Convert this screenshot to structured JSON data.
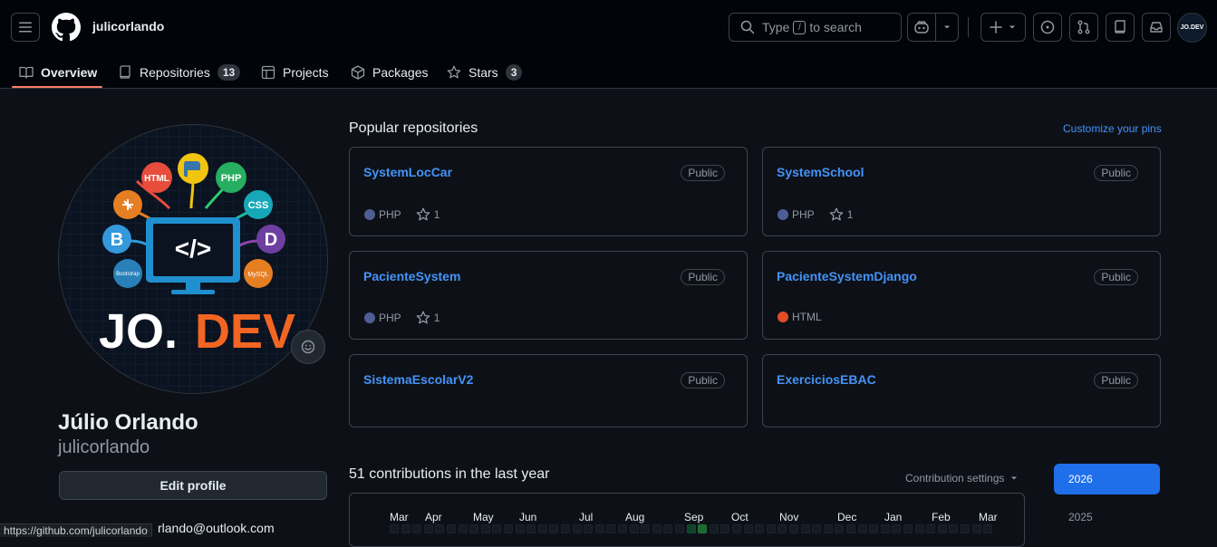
{
  "header": {
    "username": "julicorlando",
    "search_prefix": "Type",
    "search_key": "/",
    "search_suffix": "to search"
  },
  "tabs": [
    {
      "label": "Overview",
      "count": null
    },
    {
      "label": "Repositories",
      "count": "13"
    },
    {
      "label": "Projects",
      "count": null
    },
    {
      "label": "Packages",
      "count": null
    },
    {
      "label": "Stars",
      "count": "3"
    }
  ],
  "profile": {
    "avatar_text_1": "JO.",
    "avatar_text_2": "DEV",
    "avatar_top_text": "JO.DEV",
    "full_name": "Júlio Orlando",
    "login": "julicorlando",
    "edit_label": "Edit profile",
    "email": "rlando@outlook.com",
    "logo_labels": {
      "html": "HTML",
      "php": "PHP",
      "css": "CSS",
      "b": "B",
      "d": "D",
      "bootstrap": "Bootstrap",
      "mysql": "MySQL",
      "code": "</>"
    }
  },
  "status_url": "https://github.com/julicorlando",
  "popular": {
    "title": "Popular repositories",
    "customize": "Customize your pins",
    "repos": [
      {
        "name": "SystemLocCar",
        "visibility": "Public",
        "language": "PHP",
        "lang_color": "#4F5D95",
        "stars": "1"
      },
      {
        "name": "SystemSchool",
        "visibility": "Public",
        "language": "PHP",
        "lang_color": "#4F5D95",
        "stars": "1"
      },
      {
        "name": "PacienteSystem",
        "visibility": "Public",
        "language": "PHP",
        "lang_color": "#4F5D95",
        "stars": "1"
      },
      {
        "name": "PacienteSystemDjango",
        "visibility": "Public",
        "language": "HTML",
        "lang_color": "#e34c26",
        "stars": null
      },
      {
        "name": "SistemaEscolarV2",
        "visibility": "Public",
        "language": null,
        "lang_color": null,
        "stars": null
      },
      {
        "name": "ExerciciosEBAC",
        "visibility": "Public",
        "language": null,
        "lang_color": null,
        "stars": null
      }
    ]
  },
  "contributions": {
    "title": "51 contributions in the last year",
    "settings": "Contribution settings",
    "months": [
      "Mar",
      "Apr",
      "May",
      "Jun",
      "Jul",
      "Aug",
      "Sep",
      "Oct",
      "Nov",
      "Dec",
      "Jan",
      "Feb",
      "Mar"
    ],
    "years": [
      "2026",
      "2025"
    ]
  },
  "colors": {
    "accent": "#4493f8",
    "tab_underline": "#f78166",
    "year_active": "#1f6feb"
  }
}
